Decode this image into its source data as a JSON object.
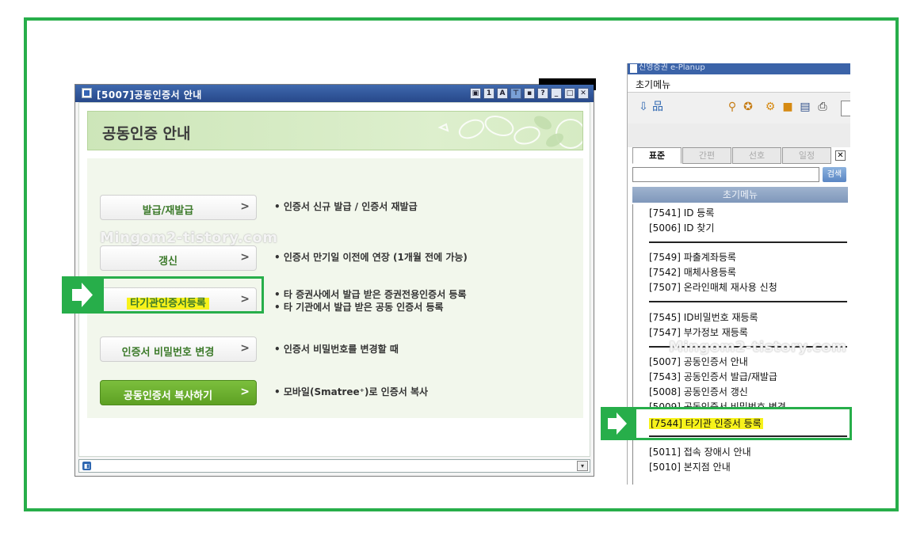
{
  "left_window": {
    "title": "[5007]공동인증서 안내",
    "toolbar_buttons": [
      "restore-icon",
      "1",
      "A",
      "pin-icon",
      "popup-icon",
      "?",
      "minimize-icon",
      "maximize-icon",
      "close-icon"
    ],
    "header_title": "공동인증 안내",
    "items": [
      {
        "label": "발급/재발급",
        "arrow": ">",
        "desc": [
          "• 인증서 신규 발급 / 인증서 재발급"
        ]
      },
      {
        "label": "갱신",
        "arrow": ">",
        "desc": [
          "• 인증서 만기일 이전에 연장 (1개월 전에 가능)"
        ]
      },
      {
        "label": "타기관인증서등록",
        "arrow": ">",
        "desc": [
          "• 타 증권사에서 발급 받은 증권전용인증서 등록",
          "• 타 기관에서 발급 받은 공동 인증서 등록"
        ]
      },
      {
        "label": "인증서 비밀번호 변경",
        "arrow": ">",
        "desc": [
          "• 인증서 비밀번호를 변경할 때"
        ]
      },
      {
        "label": "공동인증서 복사하기",
        "arrow": ">",
        "desc": [
          "• 모바일(Smatree⁺)로 인증서 복사"
        ]
      }
    ],
    "status_icon": "info-icon",
    "status_dropdown": "▾"
  },
  "watermark": "Mingom2-tistory.com",
  "right_panel": {
    "title": "신영증권 e-Planup",
    "menu_label": "초기메뉴",
    "tabs": [
      "표준",
      "간편",
      "선호",
      "일정"
    ],
    "close_glyph": "✕",
    "search_placeholder": "",
    "search_button": "검색",
    "section_title": "초기메뉴",
    "groups": [
      [
        "[7541] ID 등록",
        "[5006] ID 찾기"
      ],
      [
        "[7549] 파출계좌등록",
        "[7542] 매체사용등록",
        "[7507] 온라인매체 재사용 신청"
      ],
      [
        "[7545] ID비밀번호 재등록",
        "[7547] 부가정보 재등록"
      ],
      [
        "[5007] 공동인증서 안내",
        "[7543] 공동인증서 발급/재발급",
        "[5008] 공동인증서 갱신",
        "[5009] 공동인증서 비밀번호 변경",
        "[7544] 타기관 인증서 등록"
      ],
      [
        "[5011] 접속 장애시 안내",
        "[5010] 본지점 안내"
      ]
    ]
  },
  "colors": {
    "highlight_green": "#27ae4a",
    "highlight_yellow": "#f7f21b",
    "title_blue": "#27488a"
  }
}
